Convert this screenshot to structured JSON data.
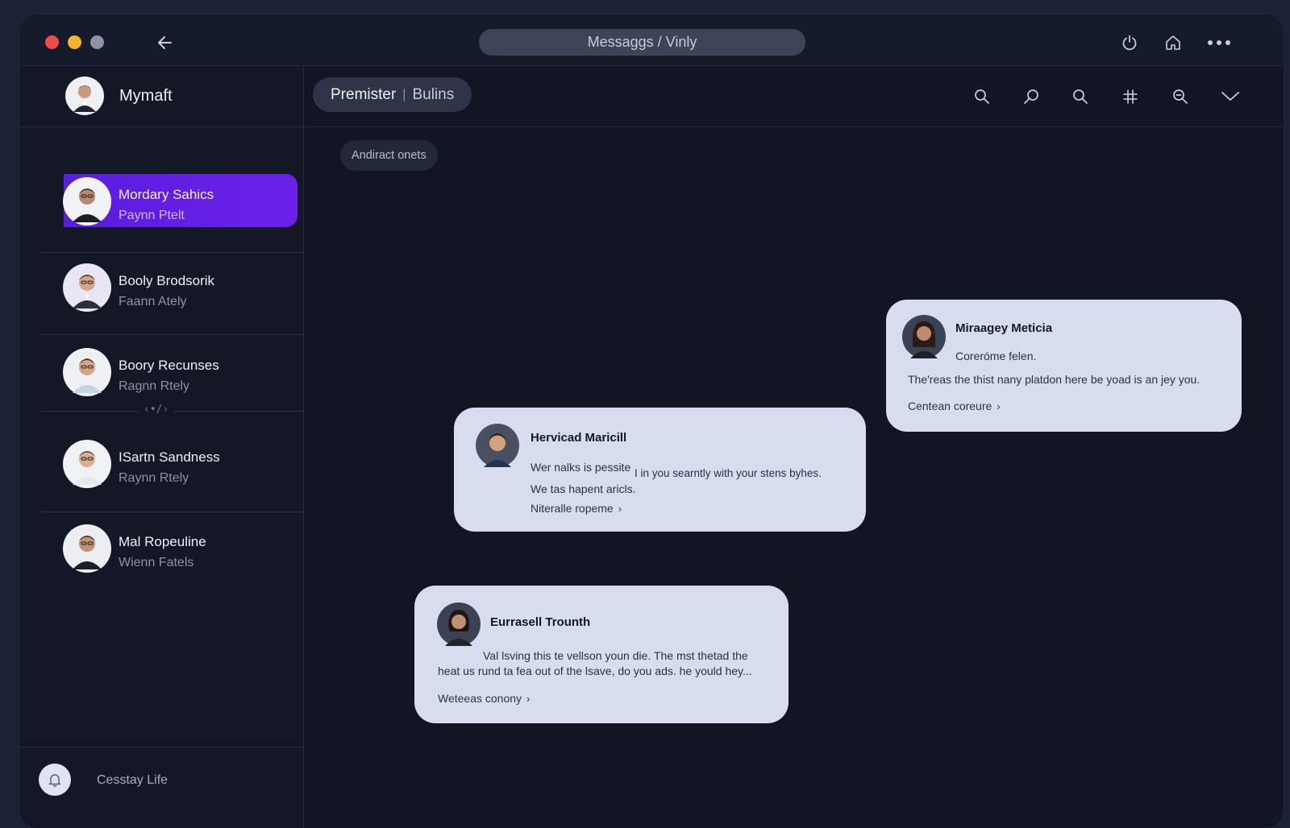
{
  "titlebar": {
    "address": "Messaggs / Vinly",
    "icons": [
      "back-arrow-icon",
      "power-icon",
      "home-icon",
      "more-icon"
    ]
  },
  "sidebar": {
    "profile_name": "Mymaft",
    "contacts": [
      {
        "name": "Mordary Sahics",
        "sub": "Paynn Ptelt",
        "active": true
      },
      {
        "name": "Booly Brodsorik",
        "sub": "Faann Ately",
        "active": false
      },
      {
        "name": "Boory Recunses",
        "sub": "Ragnn Rtely",
        "active": false
      },
      {
        "name": "ISartn Sandness",
        "sub": "Raynn Rtely",
        "active": false
      },
      {
        "name": "Mal Ropeuline",
        "sub": "Wienn Fatels",
        "active": false
      }
    ],
    "code_divider": "‹•/›",
    "footer_label": "Cesstay Life"
  },
  "main": {
    "channel": {
      "title": "Premister",
      "subtitle": "Bulins"
    },
    "header_icons": [
      "search-icon",
      "pin-search-icon",
      "search-icon",
      "hashtag-icon",
      "zoom-icon",
      "chevron-down-icon"
    ],
    "filter_chip": "Andiract onets",
    "messages": [
      {
        "name": "Miraagey Meticia",
        "line1": "Coreróme felen.",
        "line2": "The'reas the thist nany platdon here be yoad is an jey you.",
        "link": "Centean coreure"
      },
      {
        "name": "Hervicad Maricill",
        "line1a": "Wer nalks is pessite",
        "line1b": "I in you searntly with your stens byhes.",
        "line2": "We tas hapent aricls.",
        "link": "Niteralle ropeme"
      },
      {
        "name": "Eurrasell Trounth",
        "line1": "Val lsving this te vellson youn die. The mst thetad the",
        "line2": "heat us rund ta fea out of the lsave, do you ads. he yould hey...",
        "link": "Weteeas conony"
      }
    ]
  },
  "colors": {
    "background": "#121624",
    "active_item": "#6c1fe8",
    "bubble": "#d7dcef",
    "address_bar": "#3d4458"
  }
}
